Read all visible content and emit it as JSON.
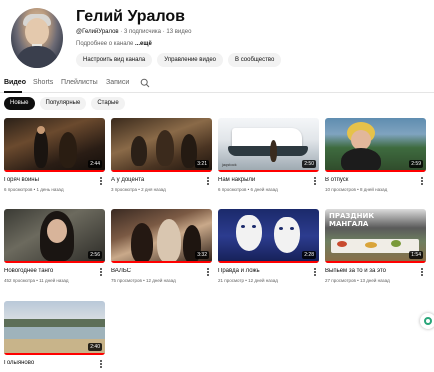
{
  "channel": {
    "name": "Гелий Уралов",
    "handle": "@ГелийУралов",
    "subscribers": "3 подписчика",
    "video_count": "13 видео",
    "description_label": "Подробнее о канале",
    "more_label": "...ещё",
    "buttons": [
      "Настроить вид канала",
      "Управление видео",
      "В сообщество"
    ]
  },
  "tabs": [
    {
      "label": "Видео",
      "active": true
    },
    {
      "label": "Shorts",
      "active": false
    },
    {
      "label": "Плейлисты",
      "active": false
    },
    {
      "label": "Записи",
      "active": false
    }
  ],
  "search_icon": "search-icon",
  "chips": [
    {
      "label": "Новые",
      "active": true
    },
    {
      "label": "Популярные",
      "active": false
    },
    {
      "label": "Старые",
      "active": false
    }
  ],
  "videos": [
    {
      "title": "Горяч войны",
      "meta": "6 просмотров • 1 день назад",
      "duration": "2:44"
    },
    {
      "title": "А у доцента",
      "meta": "3 просмотра • 2 дня назад",
      "duration": "3:21"
    },
    {
      "title": "Нам накрыли",
      "meta": "6 просмотров • 6 дней назад",
      "duration": "2:50"
    },
    {
      "title": "В отпуск",
      "meta": "10 просмотров • 8 дней назад",
      "duration": "2:59"
    },
    {
      "title": "Новогоднее танго",
      "meta": "452 просмотра • 11 дней назад",
      "duration": "2:56"
    },
    {
      "title": "ВАЛЬС",
      "meta": "75 просмотров • 12 дней назад",
      "duration": "3:32"
    },
    {
      "title": "Правда и ложь",
      "meta": "21 просмотр • 12 дней назад",
      "duration": "2:28"
    },
    {
      "title": "Выпьем за то и за это",
      "meta": "27 просмотров • 13 дней назад",
      "duration": "1:54"
    },
    {
      "title": "Голыяново",
      "meta": "",
      "duration": "2:40"
    }
  ],
  "thumb_text": {
    "yacht_watermark": "jaqstock",
    "mangal_line1": "ПРАЗДНИК",
    "mangal_line2": "МАНГАЛА"
  },
  "colors": {
    "progress": "#ff0000",
    "chip_active_bg": "#0f0f0f",
    "chip_bg": "#f2f2f2",
    "fab_accent": "#2aa67a"
  }
}
